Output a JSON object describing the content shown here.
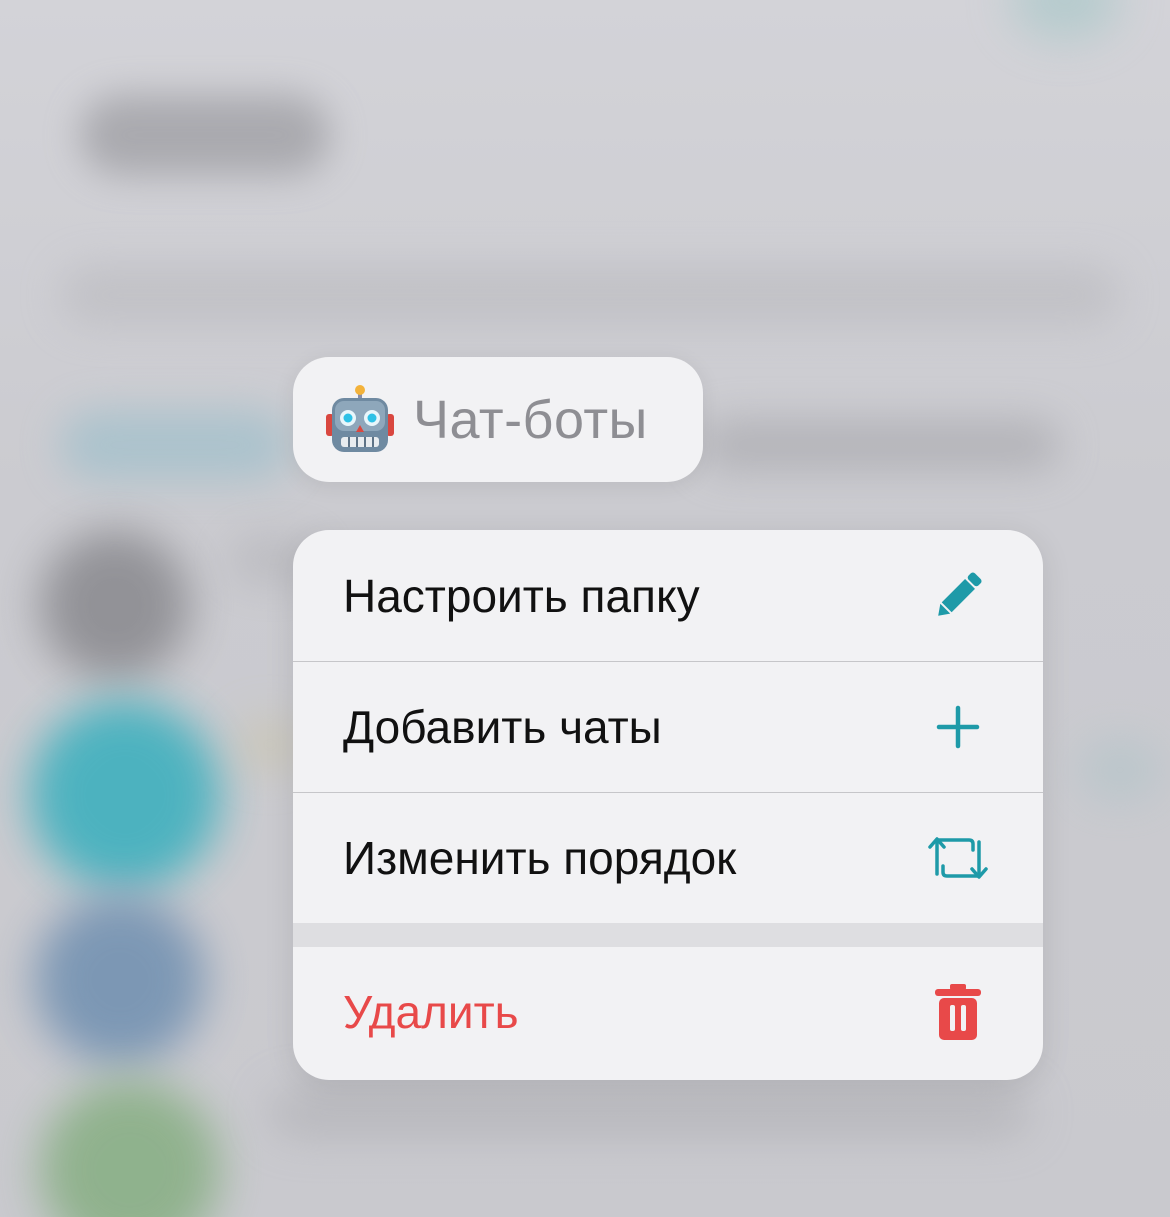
{
  "folder": {
    "title": "Чат-боты",
    "emoji_icon": "robot-face-icon"
  },
  "menu": {
    "items": [
      {
        "label": "Настроить папку",
        "icon": "pencil-icon"
      },
      {
        "label": "Добавить чаты",
        "icon": "plus-icon"
      },
      {
        "label": "Изменить порядок",
        "icon": "reorder-arrows-icon"
      }
    ],
    "danger_item": {
      "label": "Удалить",
      "icon": "trash-icon"
    }
  },
  "colors": {
    "accent": "#1e9aa8",
    "danger": "#e84949",
    "menu_background": "#f2f2f4",
    "label_text": "#111111",
    "title_text": "#8e8e93"
  }
}
